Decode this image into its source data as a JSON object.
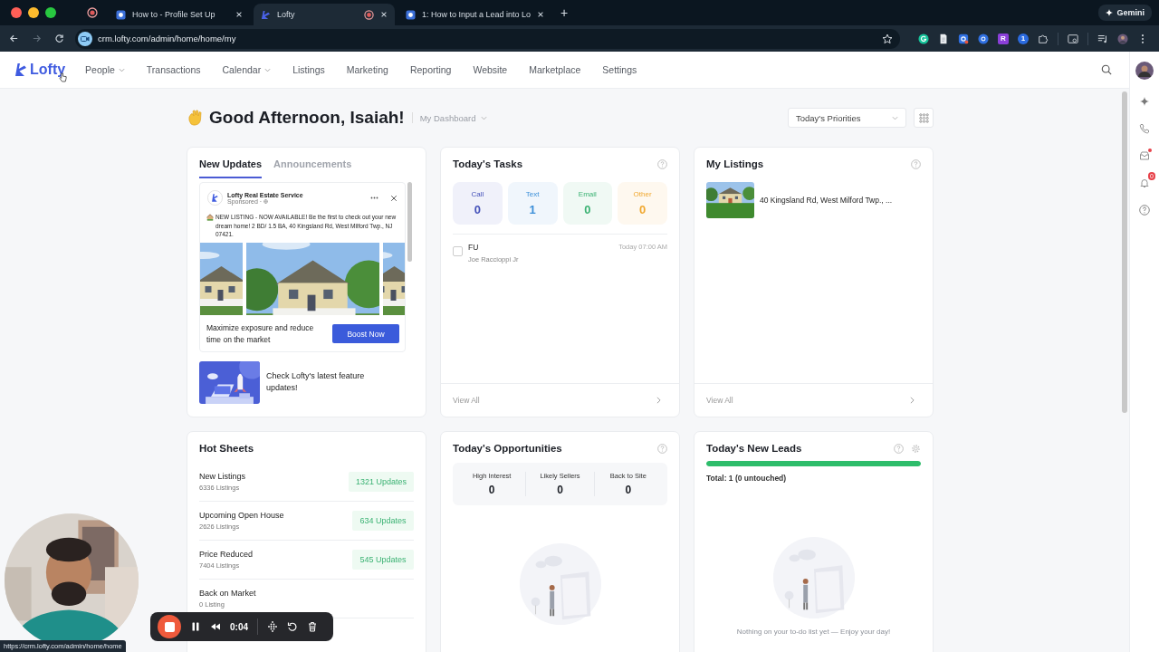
{
  "browser": {
    "tabs": [
      {
        "title": "How to - Profile Set Up",
        "kind": "site",
        "selected": false,
        "recording": false
      },
      {
        "title": "Lofty",
        "kind": "lofty",
        "selected": true,
        "recording": true
      },
      {
        "title": "1: How to Input a Lead into Lo",
        "kind": "site",
        "selected": false,
        "recording": false
      }
    ],
    "new_tab": "+",
    "gemini": "Gemini",
    "url": "crm.lofty.com/admin/home/home/my",
    "extensions": [
      {
        "kind": "g"
      },
      {
        "kind": "doc"
      },
      {
        "kind": "gear"
      },
      {
        "kind": "circle"
      },
      {
        "kind": "letter",
        "label": "R"
      },
      {
        "kind": "number",
        "label": "1"
      },
      {
        "kind": "puzzle"
      }
    ],
    "status_url": "https://crm.lofty.com/admin/home/home"
  },
  "nav": {
    "logo": "Lofty",
    "items": [
      {
        "label": "People",
        "dropdown": true
      },
      {
        "label": "Transactions",
        "dropdown": false
      },
      {
        "label": "Calendar",
        "dropdown": true
      },
      {
        "label": "Listings",
        "dropdown": false
      },
      {
        "label": "Marketing",
        "dropdown": false
      },
      {
        "label": "Reporting",
        "dropdown": false
      },
      {
        "label": "Website",
        "dropdown": false
      },
      {
        "label": "Marketplace",
        "dropdown": false
      },
      {
        "label": "Settings",
        "dropdown": false
      }
    ]
  },
  "header": {
    "greeting": "Good Afternoon, Isaiah!",
    "dashboard": "My Dashboard",
    "priorities": "Today's Priorities"
  },
  "updates": {
    "tabs": [
      {
        "label": "New Updates",
        "selected": true
      },
      {
        "label": "Announcements",
        "selected": false
      }
    ],
    "ad": {
      "page": "Lofty Real Estate Service",
      "sponsored": "Sponsored ·",
      "text": "NEW LISTING - NOW AVAILABLE! Be the first to check out your new dream home! 2 BD/ 1.5 BA, 40 Kingsland Rd, West Milford Twp., NJ 07421.",
      "cta": "Maximize exposure and reduce time on the market",
      "button": "Boost Now"
    },
    "feature": "Check Lofty's latest feature updates!"
  },
  "tasks": {
    "title": "Today's Tasks",
    "counters": [
      {
        "label": "Call",
        "value": "0",
        "color": "#4451b9"
      },
      {
        "label": "Text",
        "value": "1",
        "color": "#3b8fd8"
      },
      {
        "label": "Email",
        "value": "0",
        "color": "#3bb273"
      },
      {
        "label": "Other",
        "value": "0",
        "color": "#f0a830"
      }
    ],
    "items": [
      {
        "title": "FU",
        "contact": "Joe Raccioppi Jr",
        "time": "Today 07:00 AM",
        "checked": false
      }
    ],
    "view_all": "View All"
  },
  "listings": {
    "title": "My Listings",
    "items": [
      {
        "address": "40 Kingsland Rd, West Milford Twp., ..."
      }
    ],
    "view_all": "View All"
  },
  "hot_sheets": {
    "title": "Hot Sheets",
    "rows": [
      {
        "name": "New Listings",
        "count": "6336 Listings",
        "updates": "1321 Updates"
      },
      {
        "name": "Upcoming Open House",
        "count": "2626 Listings",
        "updates": "634 Updates"
      },
      {
        "name": "Price Reduced",
        "count": "7404 Listings",
        "updates": "545 Updates"
      },
      {
        "name": "Back on Market",
        "count": "0 Listing"
      }
    ]
  },
  "opportunities": {
    "title": "Today's Opportunities",
    "stats": [
      {
        "label": "High Interest",
        "value": "0"
      },
      {
        "label": "Likely Sellers",
        "value": "0"
      },
      {
        "label": "Back to Site",
        "value": "0"
      }
    ]
  },
  "new_leads": {
    "title": "Today's New Leads",
    "level": 1.0,
    "total": "Total: 1 (0 untouched)",
    "empty": "Nothing on your to-do list yet — Enjoy your day!"
  },
  "rail": {
    "notifications": "0",
    "inbox_unread": true
  },
  "recorder": {
    "time": "0:04"
  }
}
